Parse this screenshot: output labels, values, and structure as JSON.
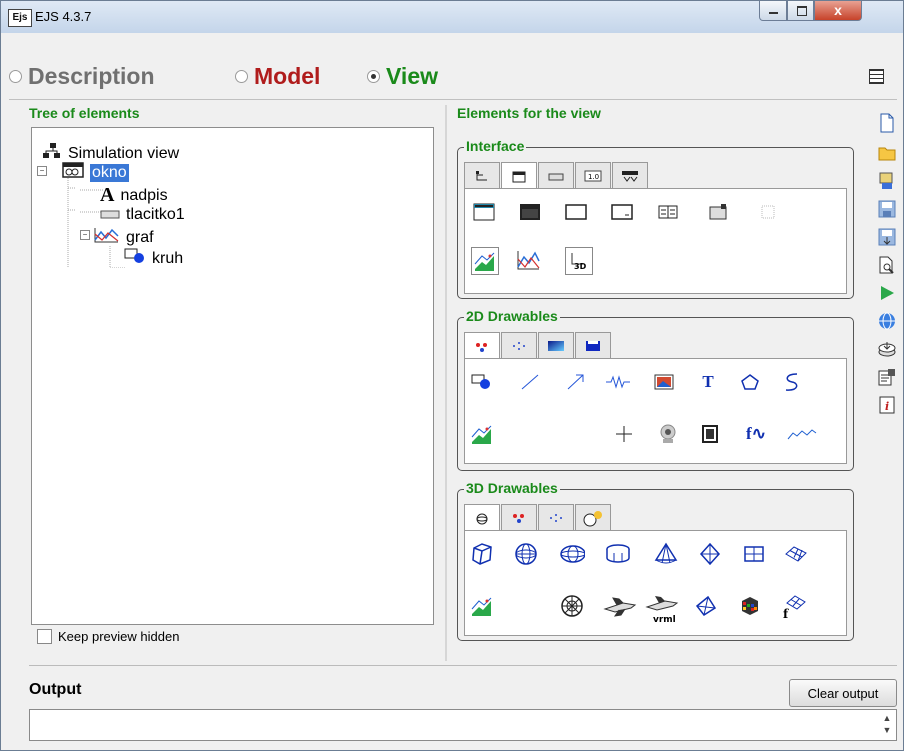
{
  "window": {
    "title": "EJS 4.3.7",
    "logo_text": "Ejs",
    "close_glyph": "x"
  },
  "modes": [
    {
      "label": "Description",
      "color": "#707070",
      "selected": false
    },
    {
      "label": "Model",
      "color": "#b01c1c",
      "selected": false
    },
    {
      "label": "View",
      "color": "#1a8a1a",
      "selected": true
    }
  ],
  "left": {
    "title": "Tree of elements",
    "tree": [
      {
        "label": "Simulation view",
        "icon": "tree-root-icon",
        "selected": false
      },
      {
        "label": "okno",
        "icon": "window-icon",
        "selected": true
      },
      {
        "label": "nadpis",
        "icon": "label-a-icon",
        "selected": false
      },
      {
        "label": "tlacitko1",
        "icon": "button-icon",
        "selected": false
      },
      {
        "label": "graf",
        "icon": "plot-icon",
        "selected": false
      },
      {
        "label": "kruh",
        "icon": "shape-icon",
        "selected": false
      }
    ],
    "keep_preview": "Keep preview hidden",
    "keep_preview_checked": false
  },
  "right": {
    "title": "Elements for the view",
    "groups": [
      {
        "title": "Interface",
        "tab_icons": [
          "tree-tab-icon",
          "window-tab-icon",
          "button-tab-icon",
          "number-field-tab-icon",
          "menu-tab-icon"
        ]
      },
      {
        "title": "2D Drawables",
        "tab_icons": [
          "particle-tab-icon",
          "points-tab-icon",
          "gradient-tab-icon",
          "panel-tab-icon"
        ]
      },
      {
        "title": "3D Drawables",
        "tab_icons": [
          "sphere-tab-icon",
          "particle-tab-icon",
          "points-tab-icon",
          "camera-light-tab-icon"
        ]
      }
    ],
    "interface_palette": [
      "frame-icon",
      "dialog-icon",
      "panel-icon",
      "scroll-panel-icon",
      "split-panel-icon",
      "tabbed-panel-icon",
      "empty-panel-icon",
      "drawing-panel-icon",
      "plotting-panel-icon",
      "3d-panel-icon"
    ],
    "text_3d": "3D",
    "drawables2d_palette": [
      "shape-icon",
      "segment-icon",
      "arrow-icon",
      "spring-icon",
      "image-icon",
      "text-icon",
      "polygon-icon",
      "trace-icon",
      "plotting-panel-icon",
      "cursor-icon",
      "camera-icon",
      "film-icon",
      "function-icon",
      "trail-icon"
    ],
    "text_T": "T",
    "text_f": "f∿",
    "drawables3d_palette": [
      "cube-icon",
      "sphere-icon",
      "ellipsoid-icon",
      "cylinder-icon",
      "cone-icon",
      "diamond-icon",
      "plane-icon",
      "surface-icon",
      "plotting-panel-icon",
      "mesh-sphere-icon",
      "wire-sphere-icon",
      "plane-model-icon",
      "shuttle-icon",
      "tetrahedron-icon",
      "rubik-icon",
      "function-surface-icon"
    ],
    "text_vrml": "vrml",
    "text_f3d": "f"
  },
  "sidebar_tools": [
    "new-icon",
    "open-icon",
    "search-icon",
    "save-icon",
    "save-as-icon",
    "preview-icon",
    "run-icon",
    "help-icon",
    "options-icon",
    "properties-icon",
    "info-icon"
  ],
  "output": {
    "title": "Output",
    "clear_label": "Clear output",
    "value": ""
  },
  "colors": {
    "accent_green": "#1a8a1a",
    "selection_blue": "#3a78d6",
    "model_red": "#b01c1c"
  }
}
